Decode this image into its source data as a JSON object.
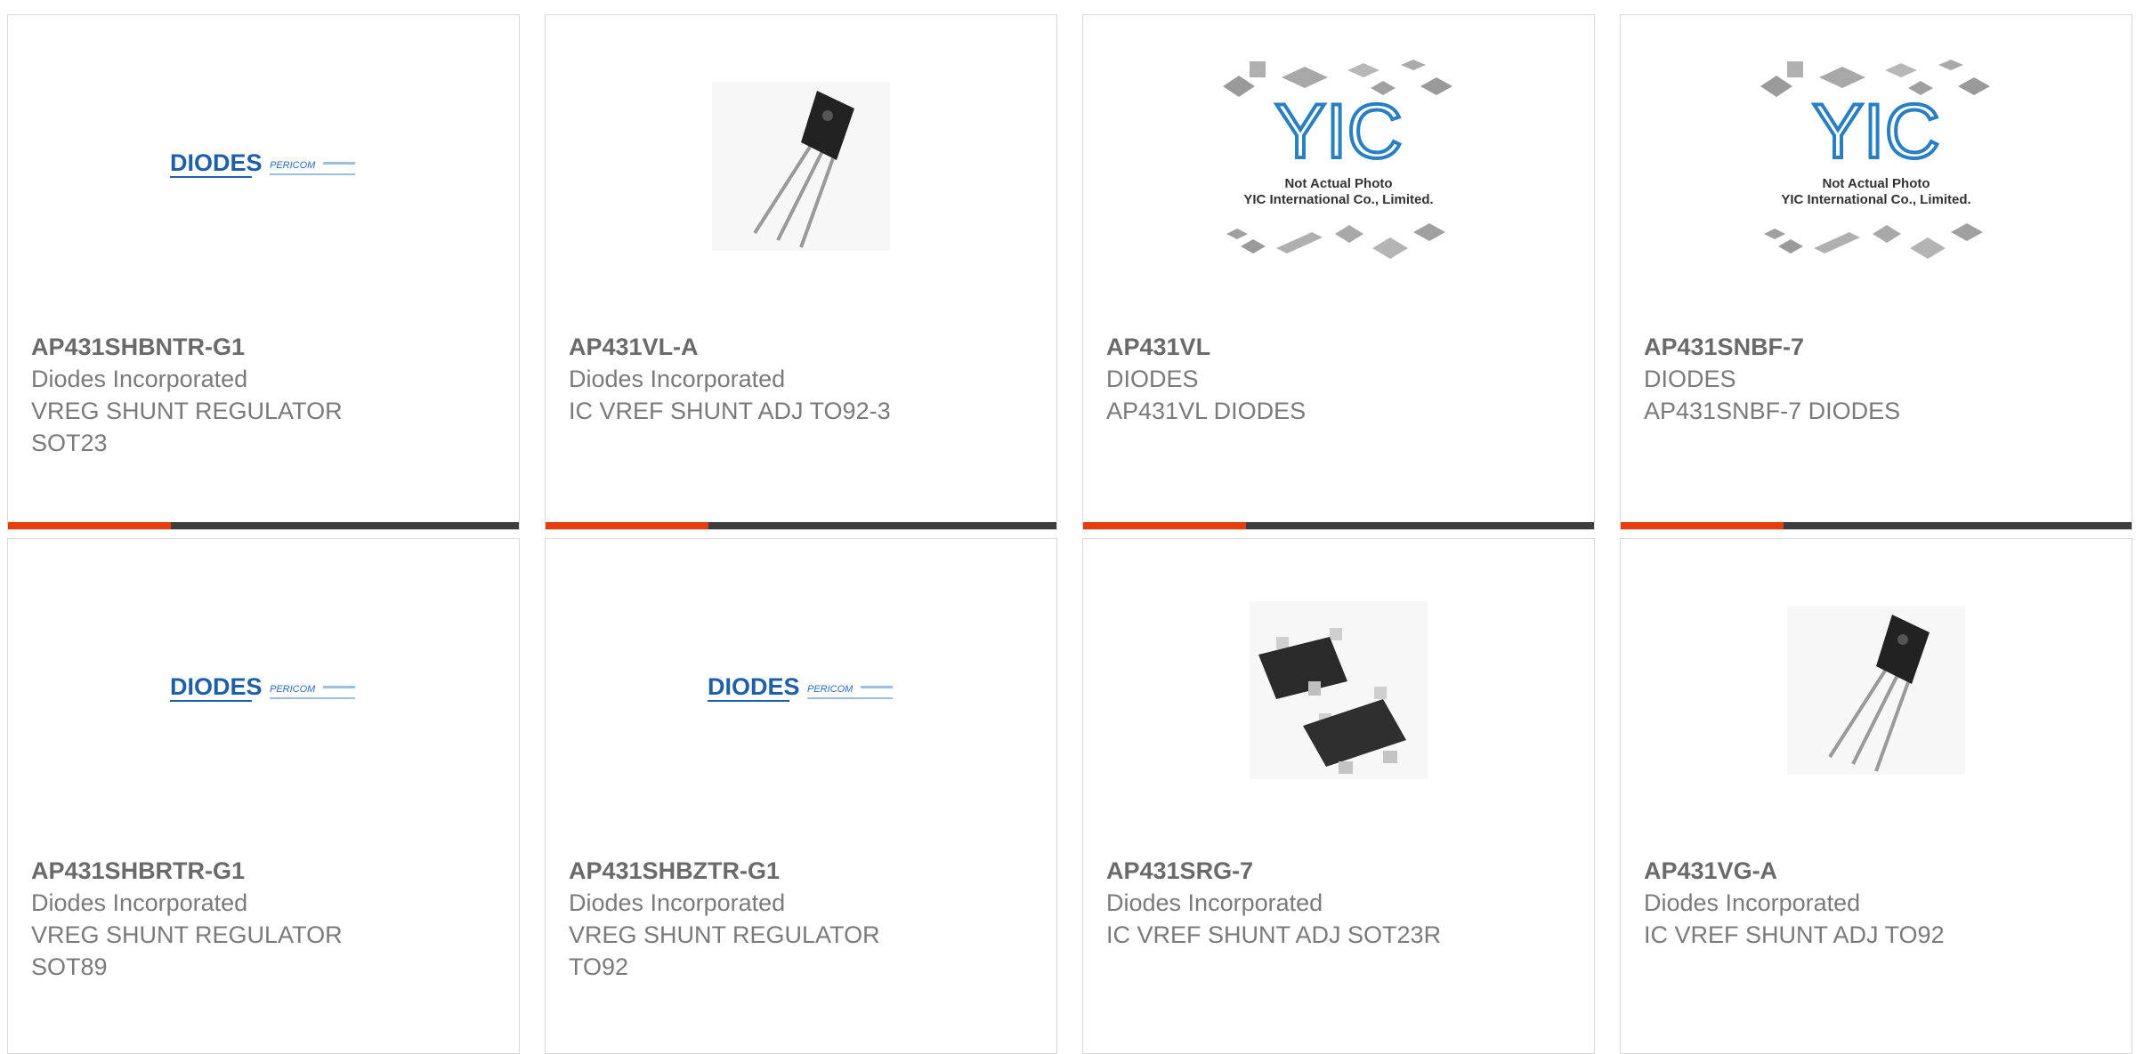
{
  "colors": {
    "accent": "#e63d0f",
    "bar_dark": "#3d3d3d",
    "border": "#d9d9d9",
    "text": "#6f6f6f"
  },
  "products": [
    {
      "part_number": "AP431SHBNTR-G1",
      "manufacturer": "Diodes Incorporated",
      "description": "VREG SHUNT REGULATOR\nSOT23",
      "image": "diodes-logo"
    },
    {
      "part_number": "AP431VL-A",
      "manufacturer": "Diodes Incorporated",
      "description": "IC VREF SHUNT ADJ TO92-3",
      "image": "to92-photo"
    },
    {
      "part_number": "AP431VL",
      "manufacturer": "DIODES",
      "description": "AP431VL DIODES",
      "image": "yic-placeholder"
    },
    {
      "part_number": "AP431SNBF-7",
      "manufacturer": "DIODES",
      "description": "AP431SNBF-7 DIODES",
      "image": "yic-placeholder"
    },
    {
      "part_number": "AP431SHBRTR-G1",
      "manufacturer": "Diodes Incorporated",
      "description": "VREG SHUNT REGULATOR\nSOT89",
      "image": "diodes-logo"
    },
    {
      "part_number": "AP431SHBZTR-G1",
      "manufacturer": "Diodes Incorporated",
      "description": "VREG SHUNT REGULATOR\nTO92",
      "image": "diodes-logo"
    },
    {
      "part_number": "AP431SRG-7",
      "manufacturer": "Diodes Incorporated",
      "description": "IC VREF SHUNT ADJ SOT23R",
      "image": "sot23-photo"
    },
    {
      "part_number": "AP431VG-A",
      "manufacturer": "Diodes Incorporated",
      "description": "IC VREF SHUNT ADJ TO92",
      "image": "to92-photo"
    }
  ],
  "placeholder": {
    "brand": "YIC",
    "line1": "Not Actual Photo",
    "line2": "YIC International Co., Limited."
  },
  "logo": {
    "brand": "DIODES",
    "sub_brand": "PERICOM"
  }
}
